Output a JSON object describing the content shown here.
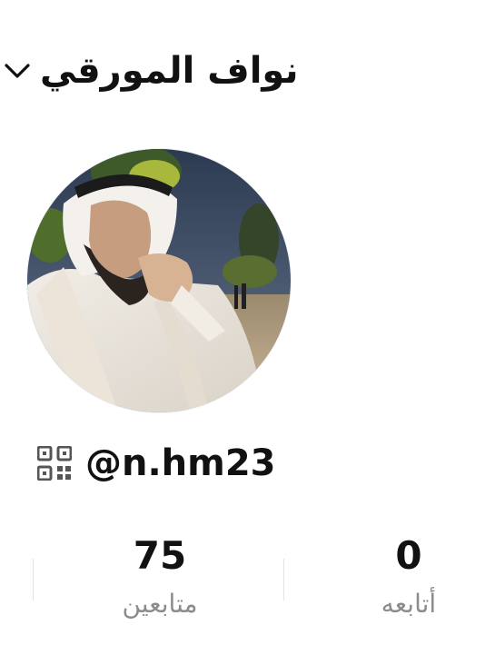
{
  "header": {
    "name": "نواف المورقي",
    "chevron_icon": "chevron-down-icon"
  },
  "profile": {
    "handle": "@n.hm23",
    "qr_icon": "qr-code-icon",
    "avatar_icon": "avatar-photo"
  },
  "stats": {
    "followers": {
      "value": "75",
      "label": "متابعين"
    },
    "following": {
      "value": "0",
      "label": "أتابعه"
    }
  },
  "colors": {
    "text": "#111111",
    "muted": "#8c8c8c",
    "divider": "#e3e3e3",
    "background": "#ffffff"
  }
}
